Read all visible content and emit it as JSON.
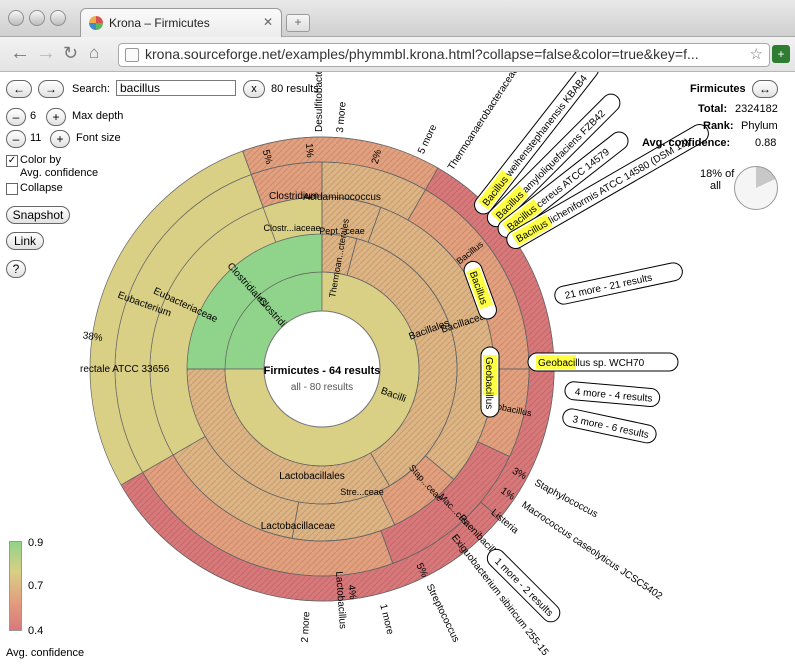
{
  "browser": {
    "tab_title": "Krona – Firmicutes",
    "url": "krona.sourceforge.net/examples/phymmbl.krona.html?collapse=false&color=true&key=f..."
  },
  "controls": {
    "search_label": "Search:",
    "search_value": "bacillus",
    "clear_label": "x",
    "results_text": "80 results",
    "max_depth_value": "6",
    "max_depth_label": "Max depth",
    "font_size_value": "11",
    "font_size_label": "Font size",
    "color_by_label": "Color by",
    "color_by_value": "Avg. confidence",
    "collapse_label": "Collapse",
    "snapshot_label": "Snapshot",
    "link_label": "Link",
    "help_label": "?",
    "minus": "–",
    "plus": "+",
    "back": "←",
    "forward": "→"
  },
  "details": {
    "name": "Firmicutes",
    "total_label": "Total:",
    "total_value": "2324182",
    "rank_label": "Rank:",
    "rank_value": "Phylum",
    "confidence_label": "Avg. confidence:",
    "confidence_value": "0.88",
    "fraction_text_1": "18% of",
    "fraction_text_2": "all"
  },
  "legend": {
    "max": "0.9",
    "mid": "0.7",
    "min": "0.4",
    "title": "Avg. confidence"
  },
  "chart": {
    "center_title": "Firmicutes - 64 results",
    "center_subtitle": "all - 80 results",
    "ring1": [
      "Clostridia",
      "Bacilli"
    ],
    "ring2": [
      "Clostridiales",
      "Bacillales",
      "Lactobacillales",
      "Thermoan...cterales"
    ],
    "ring3": [
      "Eubacteriaceae",
      "Clostr...iaceae",
      "Pept...ceae",
      "Bacillaceae",
      "Lactobacillaceae",
      "Stre...ceae",
      "Stap...ceae"
    ],
    "ring4": [
      "Eubacterium",
      "Clostridium",
      "Acidaminococcus",
      "Bacillus",
      "Geobacillus",
      "Mac...cus"
    ],
    "outer_labels": [
      "38%",
      "5%",
      "1%",
      "2%",
      "3%",
      "1%",
      "5%",
      "4%",
      "2 more",
      "1 more",
      "3 more",
      "5 more",
      "Desulfitobacterium",
      "Thermoanaerobacteraceae",
      "Staphylococcus",
      "Macrococcus caseolyticus JCSC5402",
      "Listeria",
      "Paenibacillaceae - 4 results",
      "Exiguobacterium sibiricum 255-15",
      "Streptococcus",
      "Lactobacillus",
      "rectale ATCC 33656"
    ],
    "callouts": [
      "Bacillus weihenstephanensis KBAB4",
      "Bacillus amyloliquefaciens FZB42",
      "Bacillus cereus ATCC 14579",
      "Bacillus licheniformis ATCC 14580 (DSM 13)",
      "21 more - 21 results",
      "Geobacillus sp. WCH70",
      "4 more - 4 results",
      "3 more - 6 results",
      "1 more - 2 results"
    ]
  },
  "colors": {
    "green": "#8fd48a",
    "olive": "#d9cf85",
    "tan": "#ddb484",
    "salmon": "#e2a07e",
    "red": "#d8787a",
    "highlight": "#ffff44"
  }
}
